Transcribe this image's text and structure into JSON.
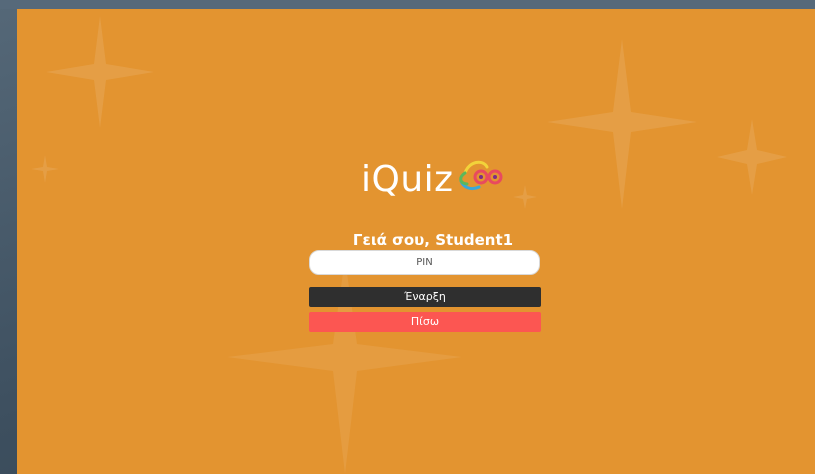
{
  "app": {
    "logo_text": "iQuiz",
    "logo_icon": "iquiz-logo-mark"
  },
  "login": {
    "greeting": "Γειά σου, Student1",
    "pin_placeholder": "PIN",
    "pin_value": "",
    "start_label": "Έναρξη",
    "back_label": "Πίσω"
  },
  "colors": {
    "outer_background": "#3d4f5f",
    "panel_background": "#e39430",
    "start_button": "#2f2f2f",
    "back_button": "#fc5652",
    "text": "#ffffff"
  }
}
